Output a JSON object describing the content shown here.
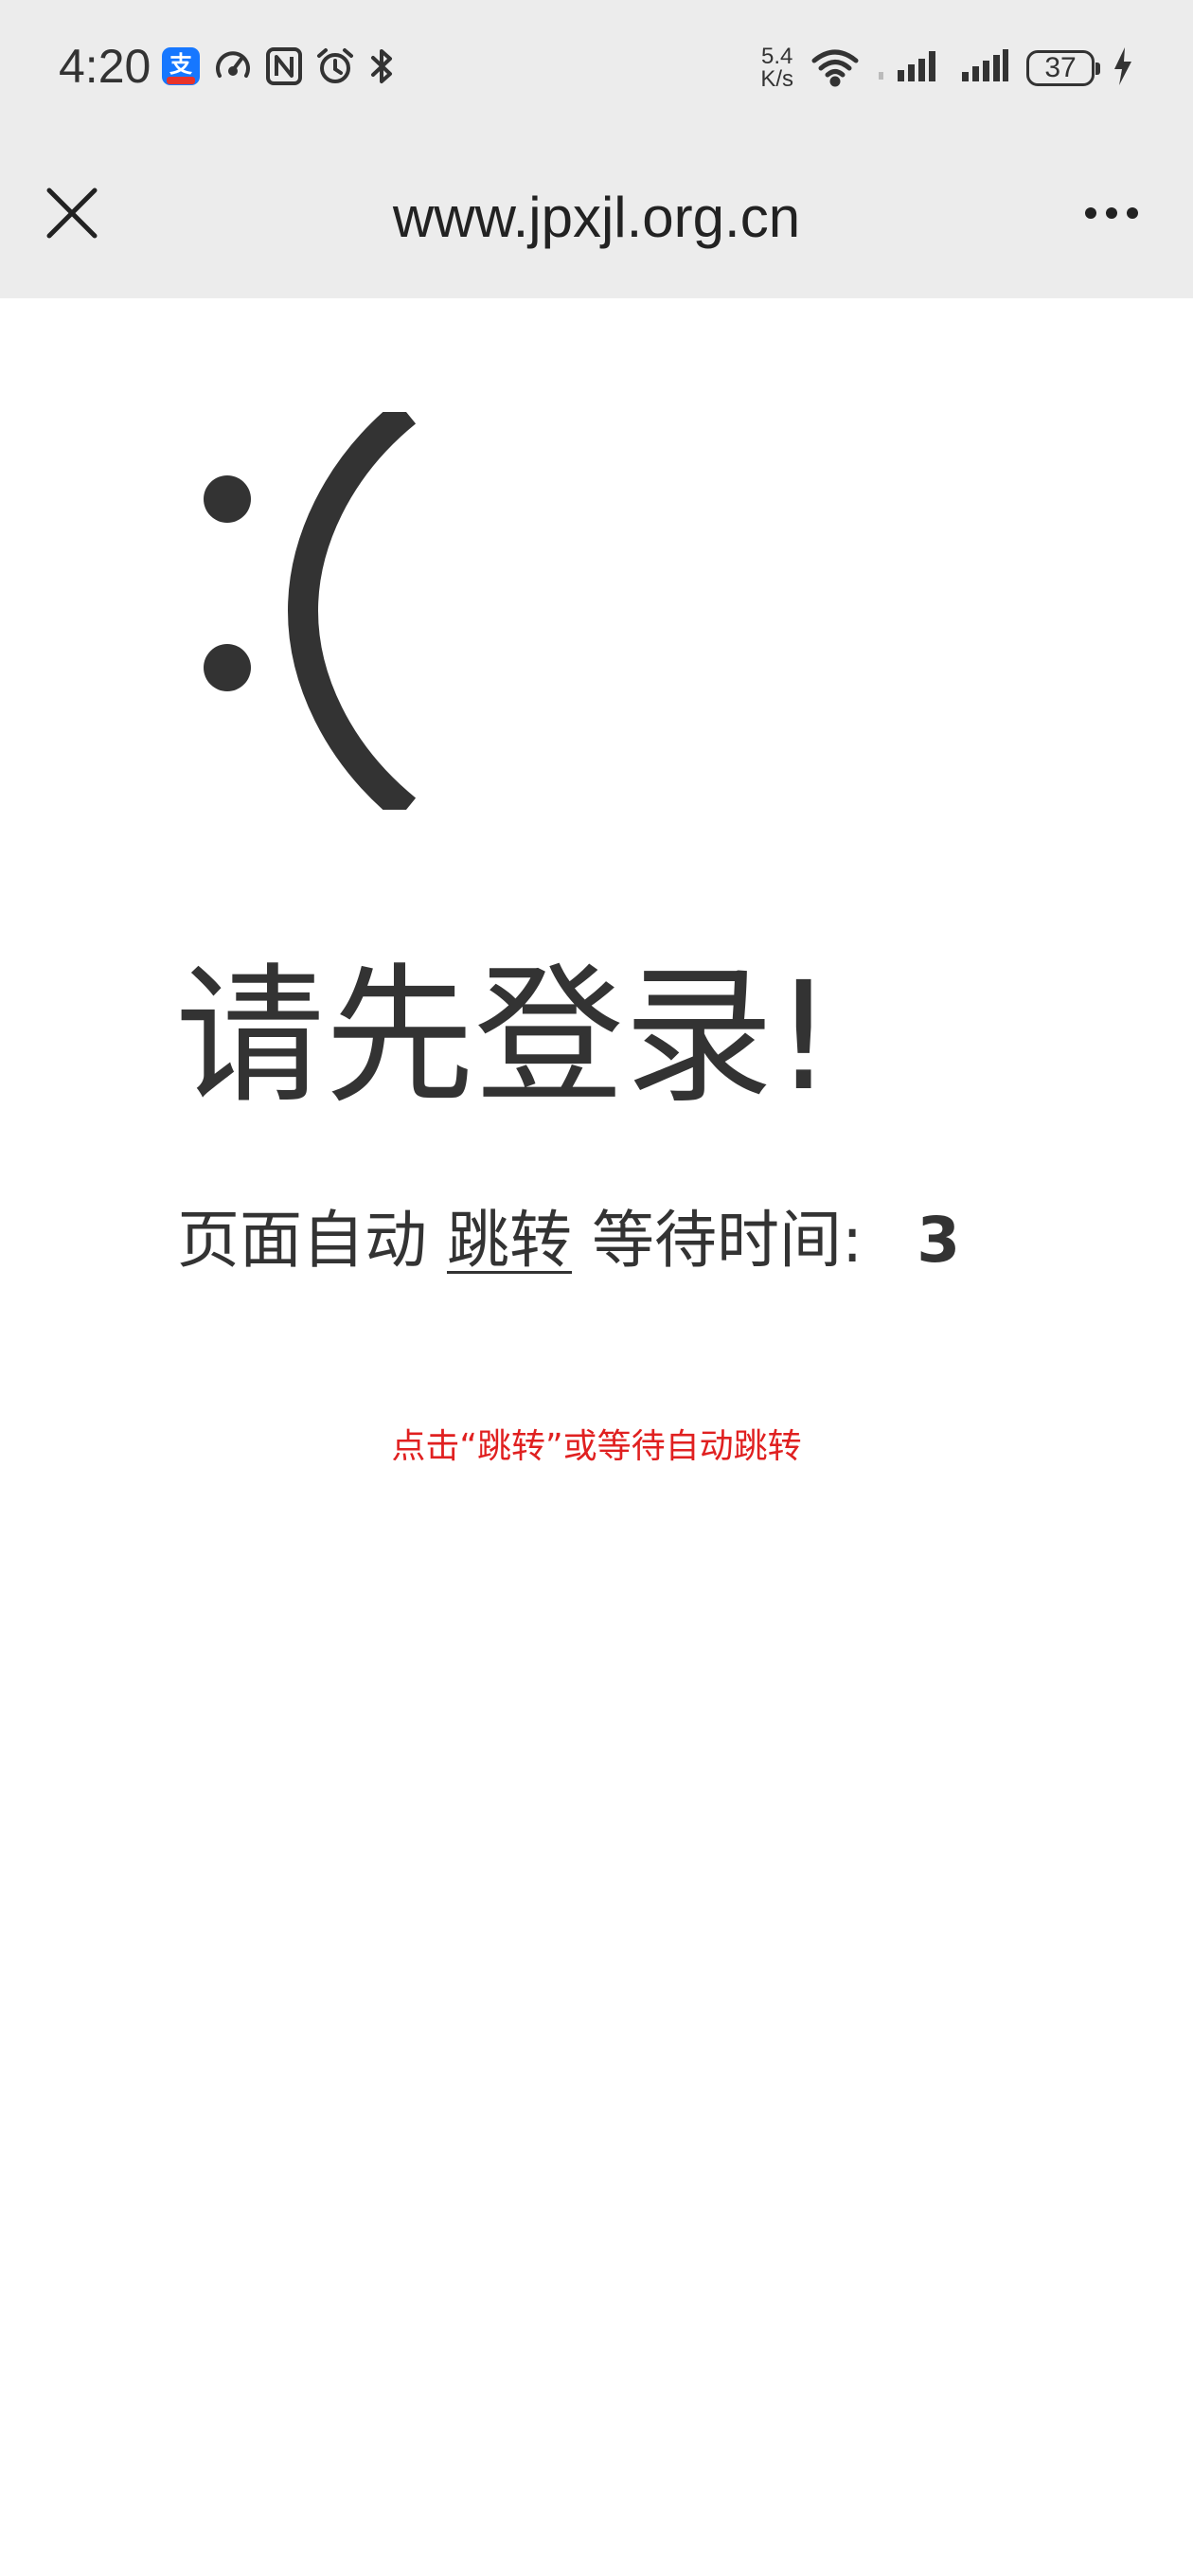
{
  "status_bar": {
    "time": "4:20",
    "net_speed_value": "5.4",
    "net_speed_unit": "K/s",
    "battery_level": "37",
    "notification_icons": [
      "alipay-icon",
      "speedometer-icon",
      "nfc-icon",
      "alarm-icon",
      "bluetooth-icon"
    ],
    "right_icons": [
      "wifi-icon",
      "signal-icon",
      "signal-icon",
      "charging-icon"
    ]
  },
  "nav": {
    "title": "www.jpxjl.org.cn",
    "close_icon": "close-icon",
    "more_icon": "more-icon"
  },
  "page": {
    "emoticon": ":(",
    "headline": "请先登录!",
    "redirect_prefix": "页面自动",
    "redirect_link": "跳转",
    "redirect_wait": "等待时间:",
    "countdown": "3",
    "hint": "点击“跳转”或等待自动跳转"
  },
  "colors": {
    "bar_background": "#ececec",
    "text": "#333333",
    "hint": "#e02020",
    "alipay_blue": "#1677ff"
  }
}
